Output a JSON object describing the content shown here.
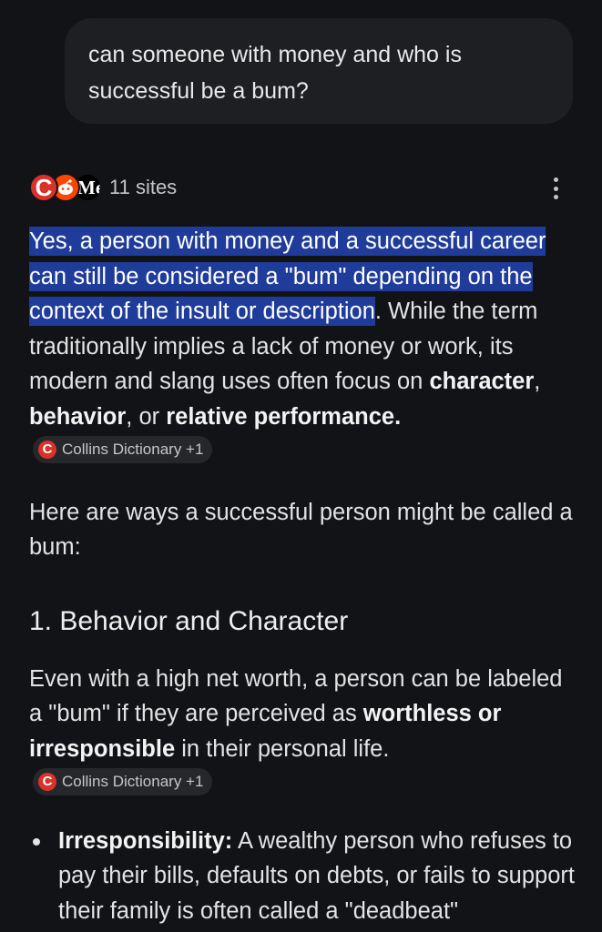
{
  "query": {
    "line1": "can someone with money and who is",
    "line2": "successful be a bum?"
  },
  "sources": {
    "count_label": "11 sites",
    "favicons": [
      "collins-dictionary",
      "reddit",
      "m-site"
    ],
    "favicon_letters": {
      "collins": "C",
      "m": "Me"
    }
  },
  "answer": {
    "highlight": "Yes, a person with money and a successful career can still be considered a \"bum\" depending on the context of the insult or description",
    "p1_rest_a": ". While the term traditionally implies a lack of money or work, its modern and slang uses often focus on ",
    "bold_character": "character",
    "comma": ", ",
    "bold_behavior": "behavior",
    "or_text": ", or ",
    "bold_relative": "relative performance.",
    "citation1": "Collins Dictionary +1",
    "p2": "Here are ways a successful person might be called a bum:",
    "heading1": "1. Behavior and Character",
    "p3_a": "Even with a high net worth, a person can be labeled a \"bum\" if they are perceived as ",
    "p3_bold": "worthless or irresponsible",
    "p3_b": " in their personal life.",
    "citation2": "Collins Dictionary +1",
    "bullet1_bold": "Irresponsibility:",
    "bullet1_text": " A wealthy person who refuses to pay their bills, defaults on debts, or fails to support their family is often called a \"deadbeat\""
  },
  "colors": {
    "background": "#121317",
    "highlight": "#203c9a",
    "bubble": "#1e1f23",
    "collins_red": "#d8322a"
  }
}
